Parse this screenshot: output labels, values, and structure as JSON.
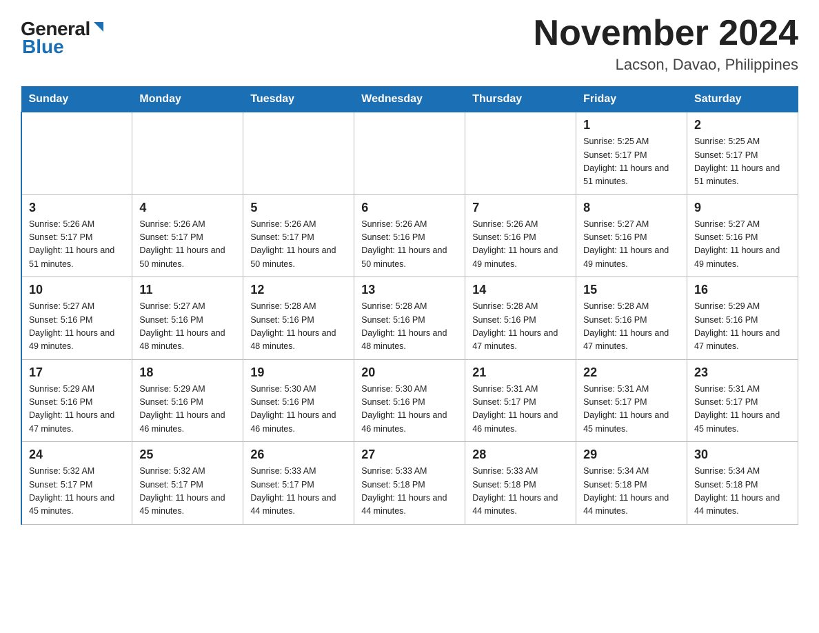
{
  "header": {
    "logo_general": "General",
    "logo_blue": "Blue",
    "title": "November 2024",
    "subtitle": "Lacson, Davao, Philippines"
  },
  "weekdays": [
    "Sunday",
    "Monday",
    "Tuesday",
    "Wednesday",
    "Thursday",
    "Friday",
    "Saturday"
  ],
  "weeks": [
    [
      {
        "day": "",
        "info": ""
      },
      {
        "day": "",
        "info": ""
      },
      {
        "day": "",
        "info": ""
      },
      {
        "day": "",
        "info": ""
      },
      {
        "day": "",
        "info": ""
      },
      {
        "day": "1",
        "info": "Sunrise: 5:25 AM\nSunset: 5:17 PM\nDaylight: 11 hours\nand 51 minutes."
      },
      {
        "day": "2",
        "info": "Sunrise: 5:25 AM\nSunset: 5:17 PM\nDaylight: 11 hours\nand 51 minutes."
      }
    ],
    [
      {
        "day": "3",
        "info": "Sunrise: 5:26 AM\nSunset: 5:17 PM\nDaylight: 11 hours\nand 51 minutes."
      },
      {
        "day": "4",
        "info": "Sunrise: 5:26 AM\nSunset: 5:17 PM\nDaylight: 11 hours\nand 50 minutes."
      },
      {
        "day": "5",
        "info": "Sunrise: 5:26 AM\nSunset: 5:17 PM\nDaylight: 11 hours\nand 50 minutes."
      },
      {
        "day": "6",
        "info": "Sunrise: 5:26 AM\nSunset: 5:16 PM\nDaylight: 11 hours\nand 50 minutes."
      },
      {
        "day": "7",
        "info": "Sunrise: 5:26 AM\nSunset: 5:16 PM\nDaylight: 11 hours\nand 49 minutes."
      },
      {
        "day": "8",
        "info": "Sunrise: 5:27 AM\nSunset: 5:16 PM\nDaylight: 11 hours\nand 49 minutes."
      },
      {
        "day": "9",
        "info": "Sunrise: 5:27 AM\nSunset: 5:16 PM\nDaylight: 11 hours\nand 49 minutes."
      }
    ],
    [
      {
        "day": "10",
        "info": "Sunrise: 5:27 AM\nSunset: 5:16 PM\nDaylight: 11 hours\nand 49 minutes."
      },
      {
        "day": "11",
        "info": "Sunrise: 5:27 AM\nSunset: 5:16 PM\nDaylight: 11 hours\nand 48 minutes."
      },
      {
        "day": "12",
        "info": "Sunrise: 5:28 AM\nSunset: 5:16 PM\nDaylight: 11 hours\nand 48 minutes."
      },
      {
        "day": "13",
        "info": "Sunrise: 5:28 AM\nSunset: 5:16 PM\nDaylight: 11 hours\nand 48 minutes."
      },
      {
        "day": "14",
        "info": "Sunrise: 5:28 AM\nSunset: 5:16 PM\nDaylight: 11 hours\nand 47 minutes."
      },
      {
        "day": "15",
        "info": "Sunrise: 5:28 AM\nSunset: 5:16 PM\nDaylight: 11 hours\nand 47 minutes."
      },
      {
        "day": "16",
        "info": "Sunrise: 5:29 AM\nSunset: 5:16 PM\nDaylight: 11 hours\nand 47 minutes."
      }
    ],
    [
      {
        "day": "17",
        "info": "Sunrise: 5:29 AM\nSunset: 5:16 PM\nDaylight: 11 hours\nand 47 minutes."
      },
      {
        "day": "18",
        "info": "Sunrise: 5:29 AM\nSunset: 5:16 PM\nDaylight: 11 hours\nand 46 minutes."
      },
      {
        "day": "19",
        "info": "Sunrise: 5:30 AM\nSunset: 5:16 PM\nDaylight: 11 hours\nand 46 minutes."
      },
      {
        "day": "20",
        "info": "Sunrise: 5:30 AM\nSunset: 5:16 PM\nDaylight: 11 hours\nand 46 minutes."
      },
      {
        "day": "21",
        "info": "Sunrise: 5:31 AM\nSunset: 5:17 PM\nDaylight: 11 hours\nand 46 minutes."
      },
      {
        "day": "22",
        "info": "Sunrise: 5:31 AM\nSunset: 5:17 PM\nDaylight: 11 hours\nand 45 minutes."
      },
      {
        "day": "23",
        "info": "Sunrise: 5:31 AM\nSunset: 5:17 PM\nDaylight: 11 hours\nand 45 minutes."
      }
    ],
    [
      {
        "day": "24",
        "info": "Sunrise: 5:32 AM\nSunset: 5:17 PM\nDaylight: 11 hours\nand 45 minutes."
      },
      {
        "day": "25",
        "info": "Sunrise: 5:32 AM\nSunset: 5:17 PM\nDaylight: 11 hours\nand 45 minutes."
      },
      {
        "day": "26",
        "info": "Sunrise: 5:33 AM\nSunset: 5:17 PM\nDaylight: 11 hours\nand 44 minutes."
      },
      {
        "day": "27",
        "info": "Sunrise: 5:33 AM\nSunset: 5:18 PM\nDaylight: 11 hours\nand 44 minutes."
      },
      {
        "day": "28",
        "info": "Sunrise: 5:33 AM\nSunset: 5:18 PM\nDaylight: 11 hours\nand 44 minutes."
      },
      {
        "day": "29",
        "info": "Sunrise: 5:34 AM\nSunset: 5:18 PM\nDaylight: 11 hours\nand 44 minutes."
      },
      {
        "day": "30",
        "info": "Sunrise: 5:34 AM\nSunset: 5:18 PM\nDaylight: 11 hours\nand 44 minutes."
      }
    ]
  ]
}
